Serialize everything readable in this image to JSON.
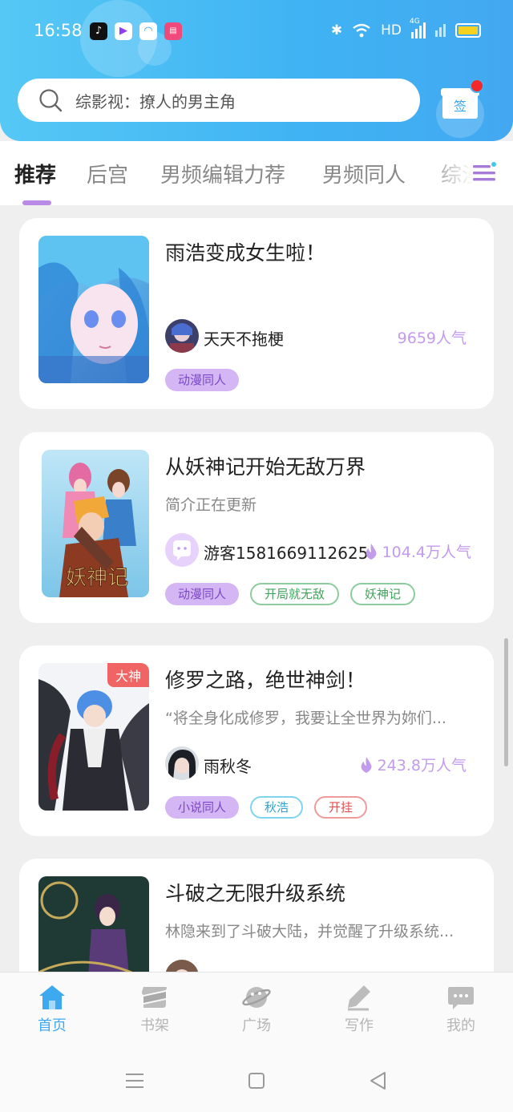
{
  "status_bar": {
    "time": "16:58",
    "network": "HD",
    "signal": "4G"
  },
  "search": {
    "placeholder": "综影视：撩人的男主角"
  },
  "signin": {
    "label": "签"
  },
  "tabs": [
    {
      "label": "推荐"
    },
    {
      "label": "后宫"
    },
    {
      "label": "男频编辑力荐"
    },
    {
      "label": "男频同人"
    },
    {
      "label": "综漫"
    }
  ],
  "books": [
    {
      "title": "雨浩变成女生啦！",
      "desc": "",
      "author": "天天不拖梗",
      "popularity": "9659人气",
      "show_fire": false,
      "badge": "",
      "tags": [
        {
          "label": "动漫同人",
          "style": "purple"
        }
      ]
    },
    {
      "title": "从妖神记开始无敌万界",
      "desc": "简介正在更新",
      "author": "游客1581669112625",
      "popularity": "104.4万人气",
      "show_fire": true,
      "badge": "",
      "tags": [
        {
          "label": "动漫同人",
          "style": "purple"
        },
        {
          "label": "开局就无敌",
          "style": "green"
        },
        {
          "label": "妖神记",
          "style": "green"
        }
      ]
    },
    {
      "title": "修罗之路，绝世神剑！",
      "desc": "“将全身化成修罗，我要让全世界为妳们...",
      "author": "雨秋冬",
      "popularity": "243.8万人气",
      "show_fire": true,
      "badge": "大神",
      "tags": [
        {
          "label": "小说同人",
          "style": "purple"
        },
        {
          "label": "秋浩",
          "style": "cyan"
        },
        {
          "label": "开挂",
          "style": "red"
        }
      ]
    },
    {
      "title": "斗破之无限升级系统",
      "desc": "林隐来到了斗破大陆，并觉醒了升级系统...",
      "author": "",
      "popularity": "",
      "show_fire": false,
      "badge": "",
      "tags": []
    }
  ],
  "cover_text": {
    "book2": "妖神记"
  },
  "bottom_nav": [
    {
      "label": "首页",
      "icon": "home-icon",
      "active": true
    },
    {
      "label": "书架",
      "icon": "bookshelf-icon",
      "active": false
    },
    {
      "label": "广场",
      "icon": "planet-icon",
      "active": false
    },
    {
      "label": "写作",
      "icon": "pen-icon",
      "active": false
    },
    {
      "label": "我的",
      "icon": "chat-bubble-icon",
      "active": false
    }
  ],
  "colors": {
    "header_start": "#56c8f5",
    "header_end": "#43a8f1",
    "accent_purple": "#b98ae6",
    "popularity": "#c39bec",
    "nav_active": "#3fa9f0"
  }
}
